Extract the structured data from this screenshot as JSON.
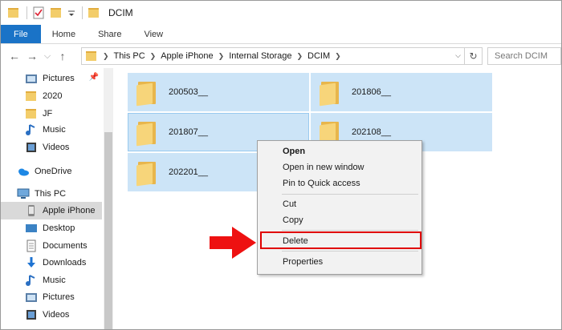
{
  "window": {
    "title": "DCIM"
  },
  "ribbon": {
    "tabs": [
      "File",
      "Home",
      "Share",
      "View"
    ]
  },
  "address": {
    "crumbs": [
      "This PC",
      "Apple iPhone",
      "Internal Storage",
      "DCIM"
    ],
    "search_placeholder": "Search DCIM"
  },
  "nav": {
    "items": [
      {
        "label": "Pictures",
        "icon": "pictures-icon"
      },
      {
        "label": "2020",
        "icon": "folder-icon"
      },
      {
        "label": "JF",
        "icon": "folder-icon"
      },
      {
        "label": "Music",
        "icon": "music-icon"
      },
      {
        "label": "Videos",
        "icon": "videos-icon"
      },
      {
        "label": "OneDrive",
        "icon": "onedrive-icon"
      },
      {
        "label": "This PC",
        "icon": "pc-icon"
      },
      {
        "label": "Apple iPhone",
        "icon": "phone-icon"
      },
      {
        "label": "Desktop",
        "icon": "desktop-icon"
      },
      {
        "label": "Documents",
        "icon": "documents-icon"
      },
      {
        "label": "Downloads",
        "icon": "downloads-icon"
      },
      {
        "label": "Music",
        "icon": "music-icon"
      },
      {
        "label": "Pictures",
        "icon": "pictures-icon"
      },
      {
        "label": "Videos",
        "icon": "videos-icon"
      }
    ]
  },
  "folders": [
    "200503__",
    "201806__",
    "201807__",
    "202108__",
    "202201__"
  ],
  "context_menu": {
    "open": "Open",
    "open_new_window": "Open in new window",
    "pin_quick_access": "Pin to Quick access",
    "cut": "Cut",
    "copy": "Copy",
    "delete": "Delete",
    "properties": "Properties"
  },
  "colors": {
    "accent": "#1a73c7",
    "selection": "#cce4f7",
    "highlight": "#e00000"
  }
}
